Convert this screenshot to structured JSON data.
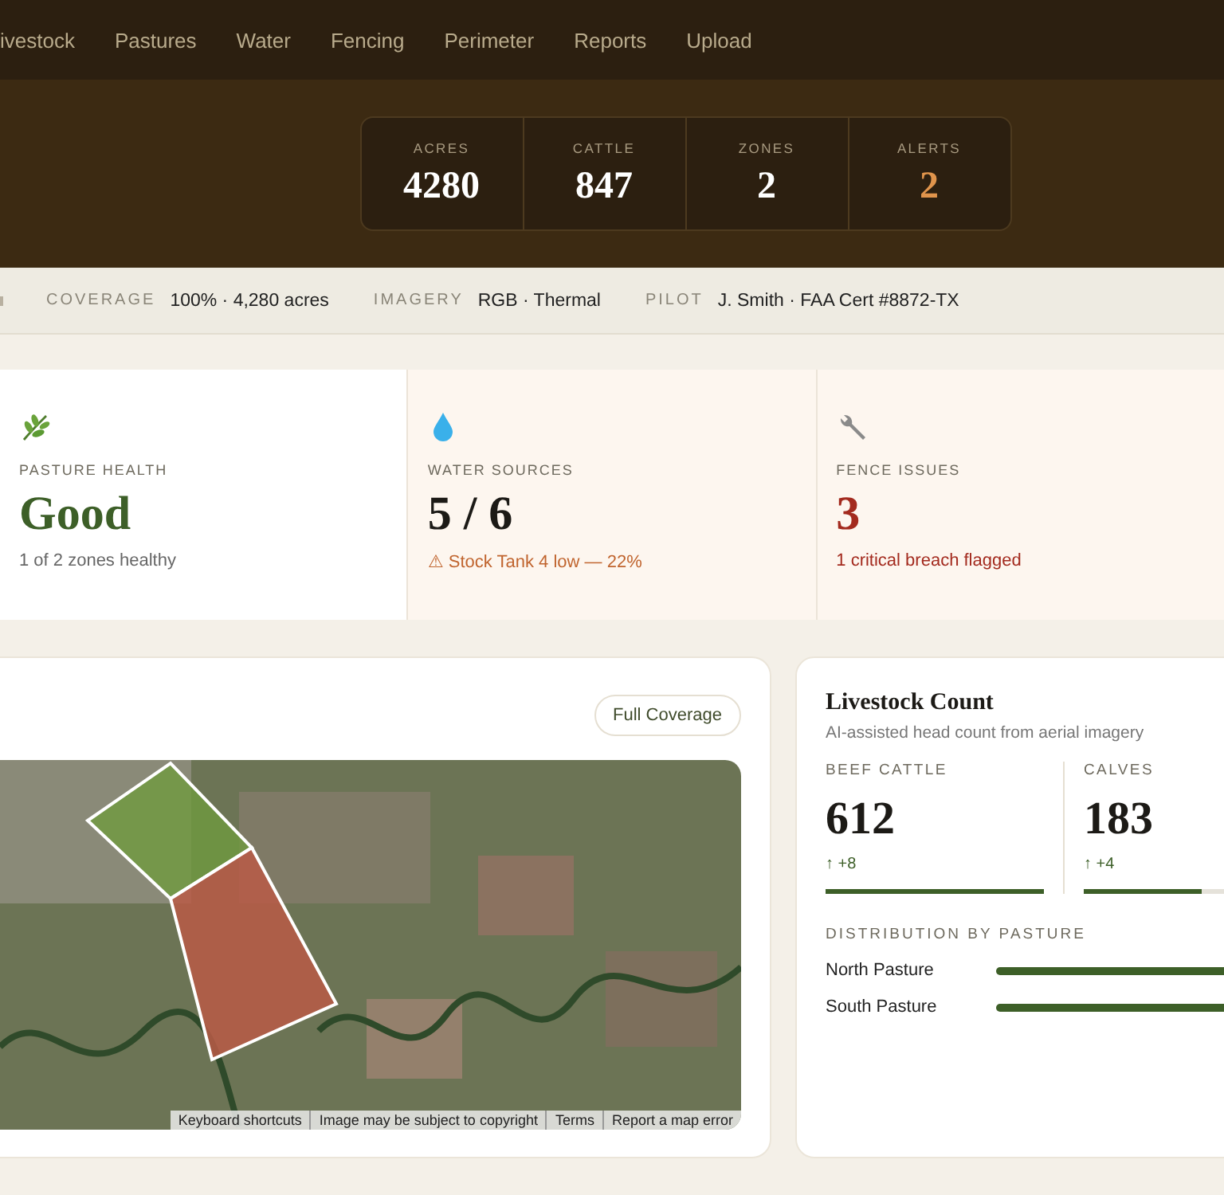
{
  "nav": {
    "items": [
      {
        "label": "ivestock",
        "selected": false
      },
      {
        "label": "Pastures",
        "selected": false
      },
      {
        "label": "Water",
        "selected": false
      },
      {
        "label": "Fencing",
        "selected": false
      },
      {
        "label": "Perimeter",
        "selected": false
      },
      {
        "label": "Reports",
        "selected": false
      },
      {
        "label": "Upload",
        "selected": false
      }
    ]
  },
  "stats": [
    {
      "label": "ACRES",
      "value": "4280",
      "kind": "normal"
    },
    {
      "label": "CATTLE",
      "value": "847",
      "kind": "normal"
    },
    {
      "label": "ZONES",
      "value": "2",
      "kind": "normal"
    },
    {
      "label": "ALERTS",
      "value": "2",
      "kind": "alert"
    }
  ],
  "info_bar": [
    {
      "label": "COVERAGE",
      "value": "100% · 4,280 acres"
    },
    {
      "label": "IMAGERY",
      "value": "RGB · Thermal"
    },
    {
      "label": "PILOT",
      "value": "J. Smith · FAA Cert #8872-TX"
    }
  ],
  "summary_cards": [
    {
      "label": "PASTURE HEALTH",
      "value": "Good",
      "note": "1 of 2 zones healthy",
      "kind": "good"
    },
    {
      "label": "WATER SOURCES",
      "value": "5 / 6",
      "note": "⚠ Stock Tank 4 low — 22%",
      "kind": "warning"
    },
    {
      "label": "FENCE ISSUES",
      "value": "3",
      "note": "1 critical breach flagged",
      "kind": "critical"
    }
  ],
  "map_card": {
    "button": "Full Coverage",
    "attribution": [
      "Keyboard shortcuts",
      "Image may be subject to copyright",
      "Terms",
      "Report a map error"
    ]
  },
  "livestock": {
    "title": "Livestock Count",
    "subtitle": "AI-assisted head count from aerial imagery",
    "counts": [
      {
        "label": "BEEF CATTLE",
        "value": "612",
        "change": "↑ +8",
        "level": 1
      },
      {
        "label": "CALVES",
        "value": "183",
        "change": "↑ +4",
        "level": 0.6
      }
    ],
    "distribution_title": "DISTRIBUTION BY PASTURE",
    "distribution": [
      {
        "name": "North Pasture",
        "level": 1
      },
      {
        "name": "South Pasture",
        "level": 1
      }
    ]
  }
}
